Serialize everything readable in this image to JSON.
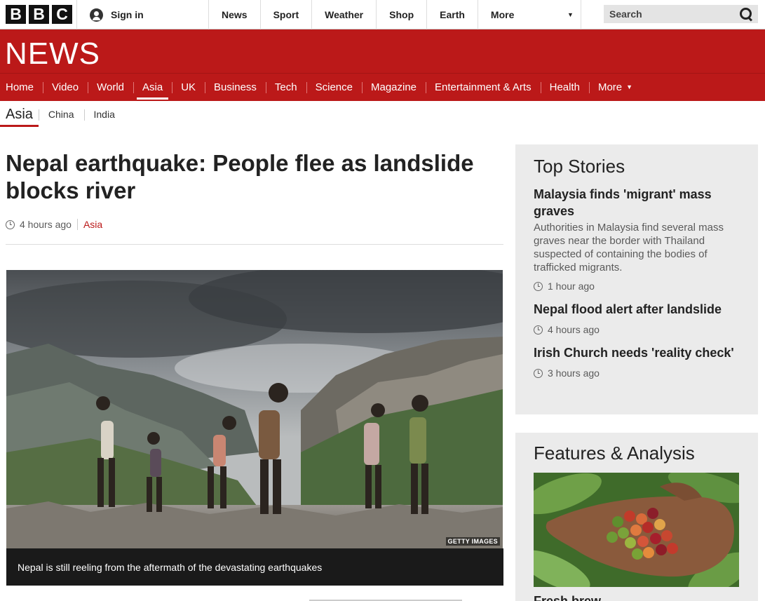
{
  "masthead": {
    "logo_letters": [
      "B",
      "B",
      "C"
    ],
    "signin_label": "Sign in",
    "nav": [
      "News",
      "Sport",
      "Weather",
      "Shop",
      "Earth"
    ],
    "more_label": "More",
    "search_placeholder": "Search"
  },
  "news": {
    "title": "NEWS",
    "sections": [
      "Home",
      "Video",
      "World",
      "Asia",
      "UK",
      "Business",
      "Tech",
      "Science",
      "Magazine",
      "Entertainment & Arts",
      "Health"
    ],
    "active_section": "Asia",
    "more_label": "More"
  },
  "subnav": {
    "current": "Asia",
    "items": [
      "China",
      "India"
    ]
  },
  "story": {
    "headline": "Nepal earthquake: People flee as landslide blocks river",
    "time": "4 hours ago",
    "category": "Asia",
    "image_credit": "GETTY IMAGES",
    "caption": "Nepal is still reeling from the aftermath of the devastating earthquakes"
  },
  "top_stories": {
    "title": "Top Stories",
    "items": [
      {
        "title": "Malaysia finds 'migrant' mass graves",
        "summary": "Authorities in Malaysia find several mass graves near the border with Thailand suspected of containing the bodies of trafficked migrants.",
        "time": "1 hour ago"
      },
      {
        "title": "Nepal flood alert after landslide",
        "summary": "",
        "time": "4 hours ago"
      },
      {
        "title": "Irish Church needs 'reality check'",
        "summary": "",
        "time": "3 hours ago"
      }
    ]
  },
  "features": {
    "title": "Features & Analysis",
    "first_item_title": "Fresh brew"
  },
  "colors": {
    "brand_red": "#bb1919",
    "sidebar_bg": "#ebebeb",
    "caption_bg": "#1a1a1a"
  }
}
